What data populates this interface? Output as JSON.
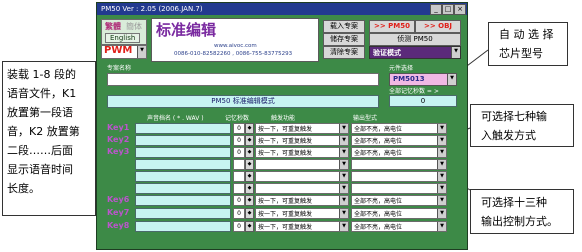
{
  "window": {
    "title": "PM50 Ver : 2.05 (2006.JAN.7)",
    "btn_min": "_",
    "btn_max": "□",
    "btn_close": "×"
  },
  "lang": {
    "simplified": "繁體",
    "traditional": "簡体",
    "english": "English"
  },
  "mode_select": {
    "value": "PWM"
  },
  "header": {
    "title": "标准编辑",
    "website": "www.aivoc.com",
    "phones": "0086-010-82582260 , 0086-755-83775293"
  },
  "buttons": {
    "load": "载入专案",
    "save": "储存专案",
    "clear": "清除专案",
    "pm50": ">> PM50",
    "obj": ">> OBJ",
    "detect": "侦测 PM50",
    "verify": "验证模式"
  },
  "project_name": {
    "label": "专案名称",
    "value": ""
  },
  "chip": {
    "label": "元件选择",
    "value": "PM5013"
  },
  "memory_total": {
    "label": "全部记忆秒数 = >",
    "value": "0"
  },
  "mode_banner": "PM50 标准编辑模式",
  "columns": {
    "voice": "声音档名 ( * . WAV )",
    "seconds": "记忆秒数",
    "trigger": "触发功能",
    "output": "输出型式"
  },
  "rows": [
    {
      "key": "Key1",
      "sec": "0",
      "trigger": "按一下，可重复触发",
      "output": "全部不亮，高电位"
    },
    {
      "key": "Key2",
      "sec": "0",
      "trigger": "按一下，可重复触发",
      "output": "全部不亮，高电位"
    },
    {
      "key": "Key3",
      "sec": "0",
      "trigger": "按一下，可重复触发",
      "output": "全部不亮，高电位"
    },
    {
      "key": "Key6",
      "sec": "0",
      "trigger": "按一下，可重复触发",
      "output": "全部不亮，高电位"
    },
    {
      "key": "Key7",
      "sec": "0",
      "trigger": "按一下，可重复触发",
      "output": "全部不亮，高电位"
    },
    {
      "key": "Key8",
      "sec": "0",
      "trigger": "按一下，可重复触发",
      "output": "全部不亮，高电位"
    }
  ],
  "annotations": {
    "chip_lines": [
      "自 动 选 择",
      "芯片型号"
    ],
    "left_lines": [
      "装载 1-8 段的",
      "语音文件，K1",
      "放置第一段语",
      "音，K2 放置第",
      "二段……后面",
      "显示语音时间",
      "长度。"
    ],
    "trigger_lines": [
      "可选择七种输",
      "入触发方式"
    ],
    "output_lines": [
      "可选择十三种",
      "输出控制方式。"
    ]
  },
  "colors": {
    "window_bg": "#3d8a47",
    "titlebar": "#223a8f",
    "input_cyan": "#c7f4f1",
    "key_label": "#bb55cc",
    "pm50_btn_text": "#ff0000"
  }
}
